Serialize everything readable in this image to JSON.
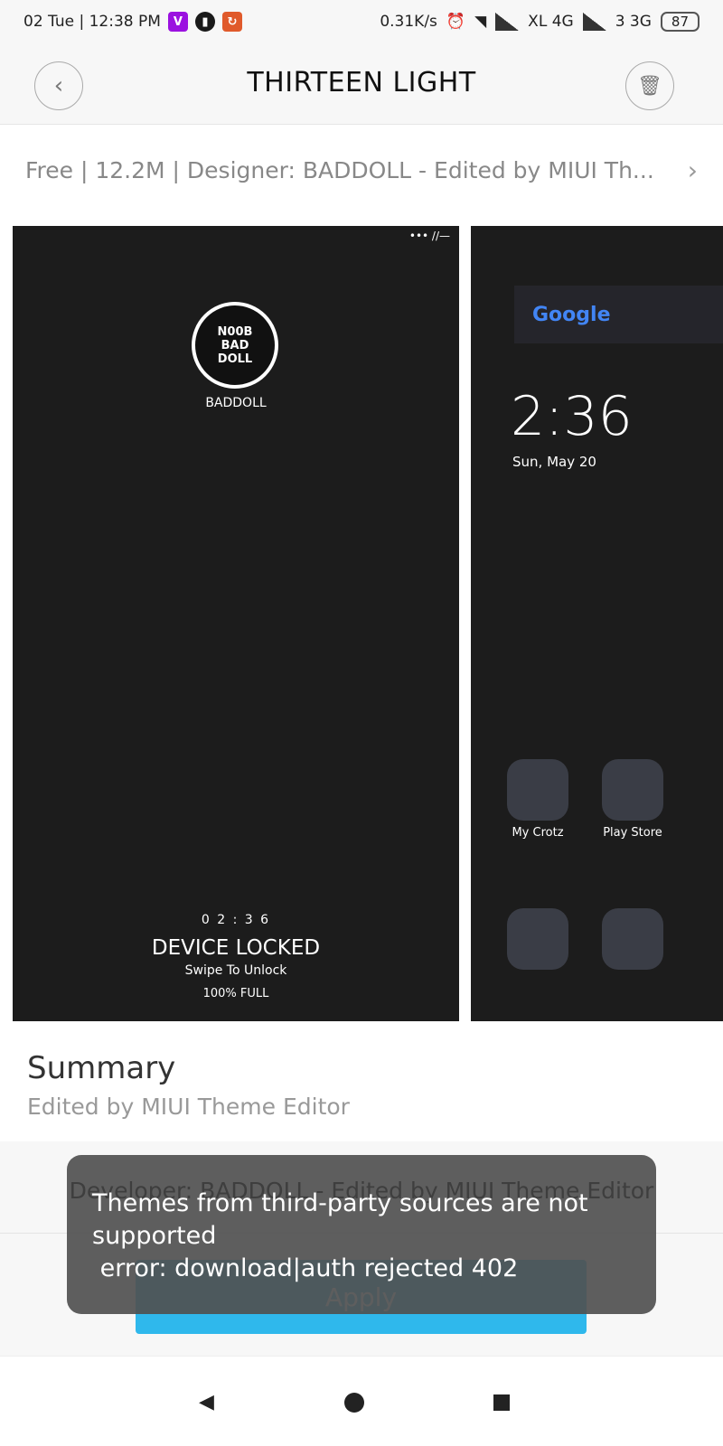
{
  "status_bar": {
    "left": "02 Tue | 12:38 PM",
    "net_speed": "0.31K/s",
    "sim1": "XL 4G",
    "sim2": "3 3G",
    "battery": "87",
    "app_icon_colors": [
      "#9b11e0",
      "#1a1a1a",
      "#e05a2b"
    ]
  },
  "header": {
    "title": "THIRTEEN LIGHT",
    "back_icon": "chevron-left",
    "delete_icon": "trash"
  },
  "info": {
    "text": "Free | 12.2M | Designer: BADDOLL - Edited by MIUI Th..."
  },
  "preview_lock": {
    "badge": "N00B BAD DOLL",
    "username": "BADDOLL",
    "time": "0 2 : 3 6",
    "locked": "DEVICE LOCKED",
    "swipe": "Swipe To Unlock",
    "battery": "100% FULL",
    "status": "••• //—"
  },
  "preview_home": {
    "google": "Google",
    "time": "2:36",
    "date": "Sun, May 20",
    "apps": [
      "My Crotz",
      "Play Store"
    ]
  },
  "summary": {
    "heading": "Summary",
    "text": "Edited by MIUI Theme Editor"
  },
  "developer": "Developer: BADDOLL - Edited by MIUI Theme Editor",
  "apply_label": "Apply",
  "accent": "#2fb8ec",
  "toast": {
    "line1": "Themes from third-party sources are not supported",
    "line2": " error: download|auth rejected 402"
  }
}
